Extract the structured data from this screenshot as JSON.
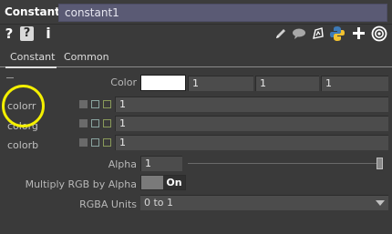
{
  "header": {
    "operator_type": "Constant",
    "operator_name": "constant1"
  },
  "toolbar": {
    "left": [
      {
        "name": "help",
        "glyph": "?"
      },
      {
        "name": "python-help",
        "glyph": "?"
      },
      {
        "name": "info",
        "glyph": "i"
      }
    ],
    "right_icons": [
      "pencil-icon",
      "comment-icon",
      "clone-icon",
      "python-icon",
      "add-icon",
      "target-icon"
    ]
  },
  "tabs": [
    {
      "label": "Constant",
      "active": true
    },
    {
      "label": "Common",
      "active": false
    }
  ],
  "params": {
    "color": {
      "label": "Color",
      "swatch": "#ffffff",
      "values": [
        "1",
        "1",
        "1"
      ]
    },
    "colorr": {
      "label": "colorr",
      "value": "1"
    },
    "colorg": {
      "label": "colorg",
      "value": "1"
    },
    "colorb": {
      "label": "colorb",
      "value": "1"
    },
    "alpha": {
      "label": "Alpha",
      "value": "1",
      "level": 1.0
    },
    "multiply": {
      "label": "Multiply RGB by Alpha",
      "state": "On"
    },
    "rgba_units": {
      "label": "RGBA Units",
      "value": "0 to 1"
    }
  },
  "annotation": {
    "color": "#f4f000"
  }
}
